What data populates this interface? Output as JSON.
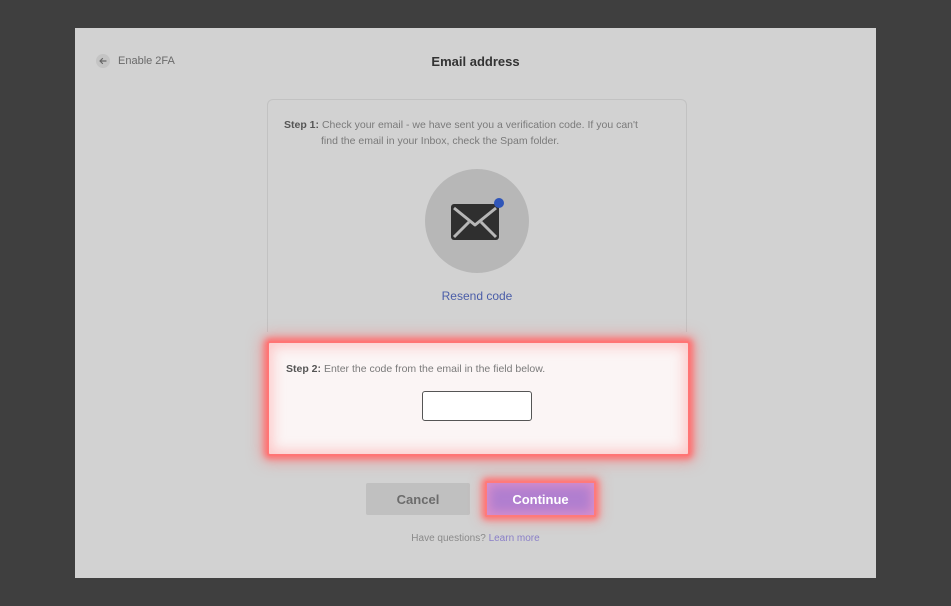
{
  "header": {
    "back_label": "Enable 2FA",
    "title": "Email address"
  },
  "step1": {
    "label": "Step 1:",
    "text_line1": "Check your email - we have sent you a verification code. If you can't",
    "text_line2": "find the email in your Inbox, check the Spam folder.",
    "resend_label": "Resend code"
  },
  "step2": {
    "label": "Step 2:",
    "text": "Enter the code from the email in the field below.",
    "code_value": "",
    "code_placeholder": ""
  },
  "actions": {
    "cancel_label": "Cancel",
    "continue_label": "Continue"
  },
  "footer": {
    "question": "Have questions?",
    "learn_more": "Learn more"
  },
  "colors": {
    "overlay": "#3f3f3f",
    "panel": "#d2d2d2",
    "accent": "#b17fd0",
    "highlight": "#ff7575",
    "link": "#4a5da8",
    "notification_dot": "#2f55b8"
  },
  "icons": {
    "back": "arrow-left-icon",
    "mail": "envelope-icon"
  }
}
